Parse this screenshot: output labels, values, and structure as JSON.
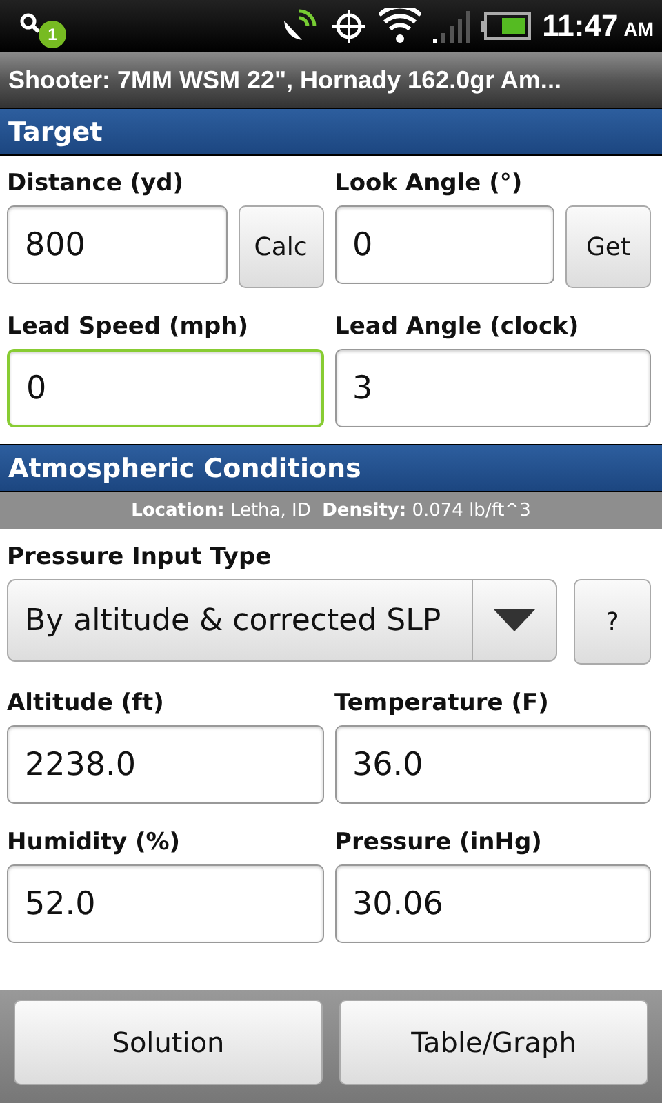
{
  "status_bar": {
    "notification_count": "1",
    "time": "11:47",
    "ampm": "AM"
  },
  "title_bar": {
    "title": "Shooter: 7MM WSM 22\", Hornady 162.0gr Am..."
  },
  "sections": [
    {
      "title": "Target",
      "rows": [
        {
          "fields": [
            {
              "label": "Distance (yd)",
              "value": "800",
              "focused": false,
              "button": "Calc"
            },
            {
              "label": "Look Angle (°)",
              "value": "0",
              "focused": false,
              "button": "Get"
            }
          ]
        },
        {
          "fields": [
            {
              "label": "Lead Speed (mph)",
              "value": "0",
              "focused": true
            },
            {
              "label": "Lead Angle (clock)",
              "value": "3",
              "focused": false
            }
          ]
        }
      ]
    },
    {
      "title": "Atmospheric Conditions",
      "info": "**Location:** Letha, ID  **Density:** 0.074 lb/ft^3",
      "dropdown": {
        "label": "Pressure Input Type",
        "value": "By altitude & corrected SLP",
        "help": "?"
      },
      "rows": [
        {
          "fields": [
            {
              "label": "Altitude (ft)",
              "value": "2238.0",
              "focused": false
            },
            {
              "label": "Temperature (F)",
              "value": "36.0",
              "focused": false
            }
          ]
        },
        {
          "fields": [
            {
              "label": "Humidity (%)",
              "value": "52.0",
              "focused": false
            },
            {
              "label": "Pressure (inHg)",
              "value": "30.06",
              "focused": false
            }
          ]
        }
      ]
    }
  ],
  "buttons": [
    "Solution",
    "Table/Graph"
  ]
}
